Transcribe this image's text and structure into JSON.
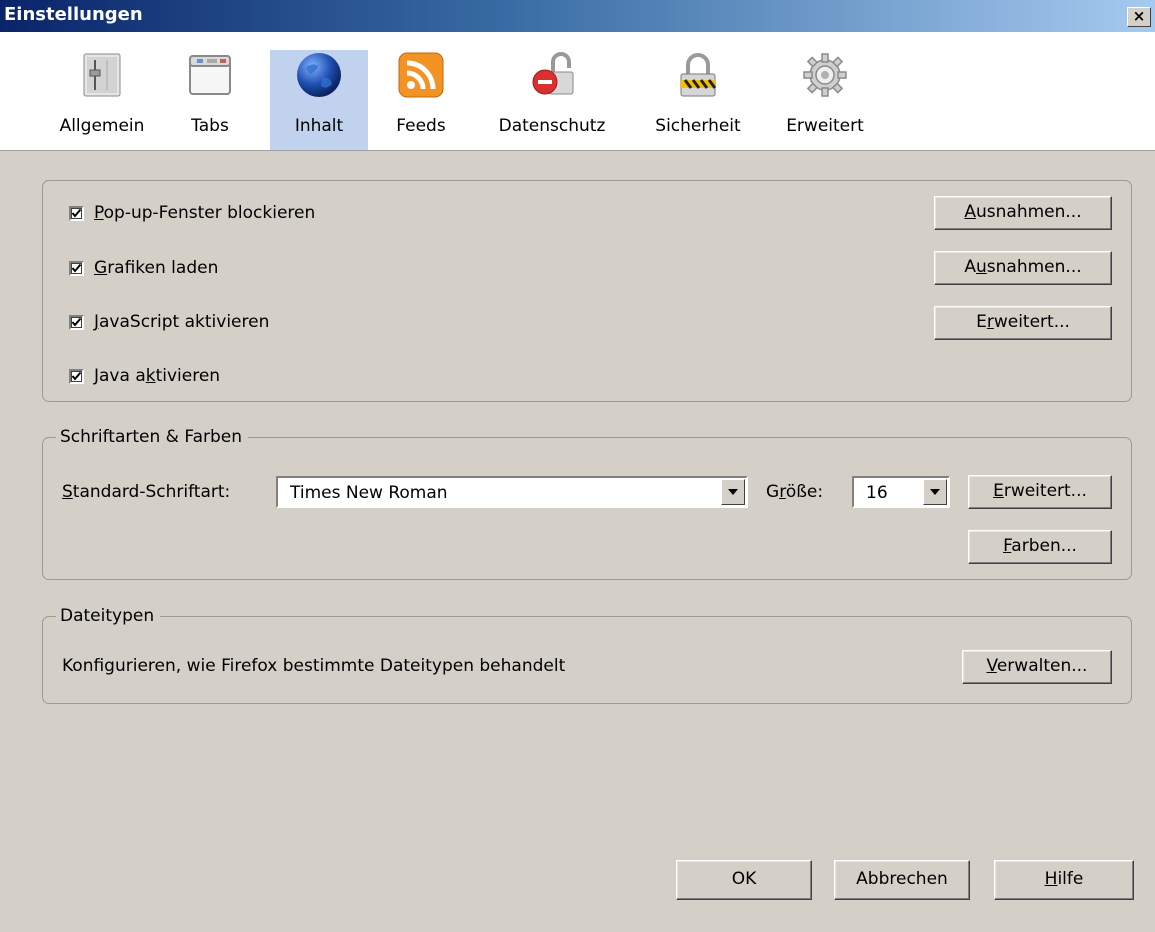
{
  "window": {
    "title": "Einstellungen",
    "close_glyph": "×"
  },
  "toolbar": {
    "tabs": [
      {
        "label": "Allgemein",
        "icon": "slider-panel-icon",
        "selected": false
      },
      {
        "label": "Tabs",
        "icon": "tabs-window-icon",
        "selected": false
      },
      {
        "label": "Inhalt",
        "icon": "globe-icon",
        "selected": true
      },
      {
        "label": "Feeds",
        "icon": "rss-feed-icon",
        "selected": false
      },
      {
        "label": "Datenschutz",
        "icon": "privacy-lock-icon",
        "selected": false
      },
      {
        "label": "Sicherheit",
        "icon": "padlock-icon",
        "selected": false
      },
      {
        "label": "Erweitert",
        "icon": "gear-icon",
        "selected": false
      }
    ]
  },
  "content": {
    "options": [
      {
        "pre": "",
        "key": "P",
        "post": "op-up-Fenster blockieren",
        "checked": true,
        "button": {
          "pre": "",
          "key": "A",
          "post": "usnahmen..."
        }
      },
      {
        "pre": "",
        "key": "G",
        "post": "rafiken laden",
        "checked": true,
        "button": {
          "pre": "A",
          "key": "u",
          "post": "snahmen..."
        }
      },
      {
        "pre": "",
        "key": "J",
        "post": "avaScript aktivieren",
        "checked": true,
        "button": {
          "pre": "E",
          "key": "r",
          "post": "weitert..."
        }
      },
      {
        "pre": "Java a",
        "key": "k",
        "post": "tivieren",
        "checked": true
      }
    ]
  },
  "fonts": {
    "legend": "Schriftarten & Farben",
    "default_font_label": {
      "pre": "",
      "key": "S",
      "post": "tandard-Schriftart:"
    },
    "default_font_value": "Times New Roman",
    "size_label": {
      "pre": "G",
      "key": "r",
      "post": "öße:"
    },
    "size_value": "16",
    "advanced_button": {
      "pre": "",
      "key": "E",
      "post": "rweitert..."
    },
    "colors_button": {
      "pre": "",
      "key": "F",
      "post": "arben..."
    }
  },
  "filetypes": {
    "legend": "Dateitypen",
    "description": "Konfigurieren, wie Firefox bestimmte Dateitypen behandelt",
    "manage_button": {
      "pre": "",
      "key": "V",
      "post": "erwalten..."
    }
  },
  "footer": {
    "ok": "OK",
    "cancel": "Abbrechen",
    "help": {
      "pre": "",
      "key": "H",
      "post": "ilfe"
    }
  },
  "colors": {
    "selected_tab": "#c1d2ee",
    "dialog_bg": "#d4d0c8",
    "title_start": "#0a246a"
  }
}
